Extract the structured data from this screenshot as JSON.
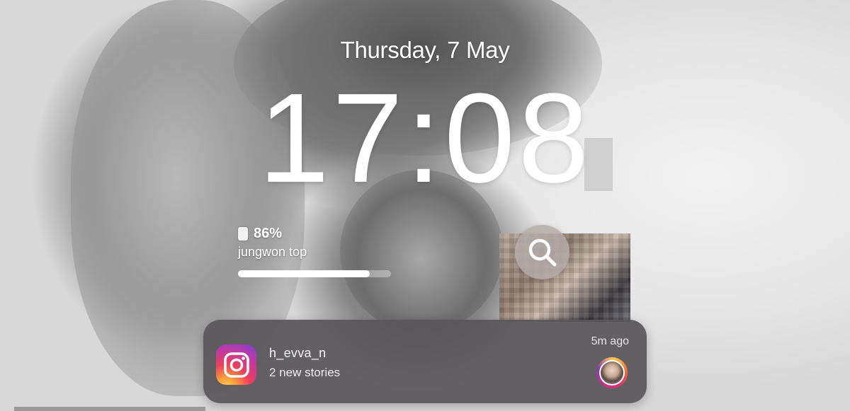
{
  "lockscreen": {
    "date": "Thursday, 7 May",
    "time": "17:08"
  },
  "battery_widget": {
    "percent_label": "86%",
    "level": 0.86,
    "device_name": "jungwon top",
    "icon": "battery-icon"
  },
  "search_widget": {
    "icon": "search-icon"
  },
  "notification": {
    "app_icon": "instagram-icon",
    "sender": "h_evva_n",
    "message": "2 new stories",
    "time_ago": "5m ago",
    "avatar": "profile-avatar"
  },
  "colors": {
    "text": "#ffffff",
    "notification_bg": "#585659",
    "instagram_gradient": [
      "#fdda5f",
      "#f9a23a",
      "#ef3f5b",
      "#c53a9b",
      "#7c3fd8"
    ]
  }
}
